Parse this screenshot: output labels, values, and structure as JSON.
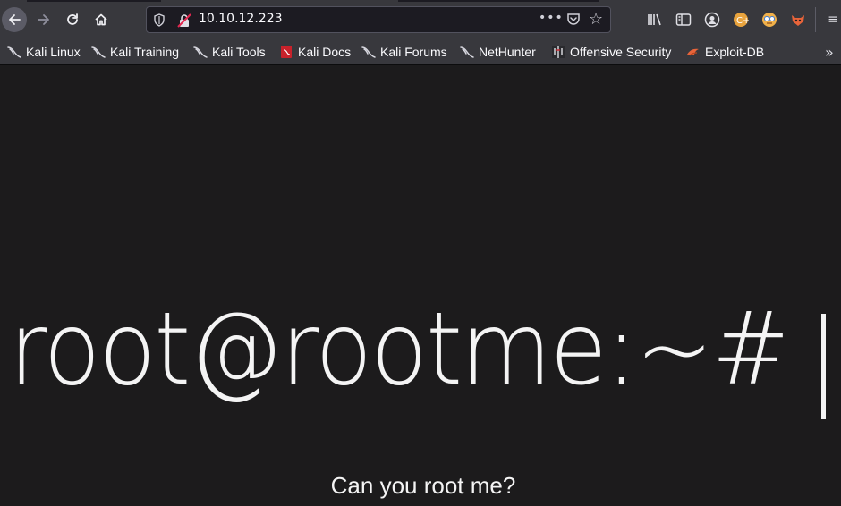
{
  "browser": {
    "url": "10.10.12.223",
    "url_more": "•••",
    "menu_glyph": "≡",
    "overflow_glyph": "»"
  },
  "bookmarks": [
    {
      "label": "Kali Linux",
      "icon": "kali-dragon-icon"
    },
    {
      "label": "Kali Training",
      "icon": "kali-dragon-icon"
    },
    {
      "label": "Kali Tools",
      "icon": "kali-dragon-icon"
    },
    {
      "label": "Kali Docs",
      "icon": "kali-docs-icon"
    },
    {
      "label": "Kali Forums",
      "icon": "kali-dragon-icon"
    },
    {
      "label": "NetHunter",
      "icon": "kali-dragon-icon"
    },
    {
      "label": "Offensive Security",
      "icon": "offsec-icon"
    },
    {
      "label": "Exploit-DB",
      "icon": "exploit-db-icon"
    }
  ],
  "page": {
    "heading": "root@rootme:~#",
    "subtitle": "Can you root me?"
  },
  "colors": {
    "toolbar": "#38383d",
    "page_bg": "#1c1b1c",
    "text": "#f4f4f4"
  }
}
